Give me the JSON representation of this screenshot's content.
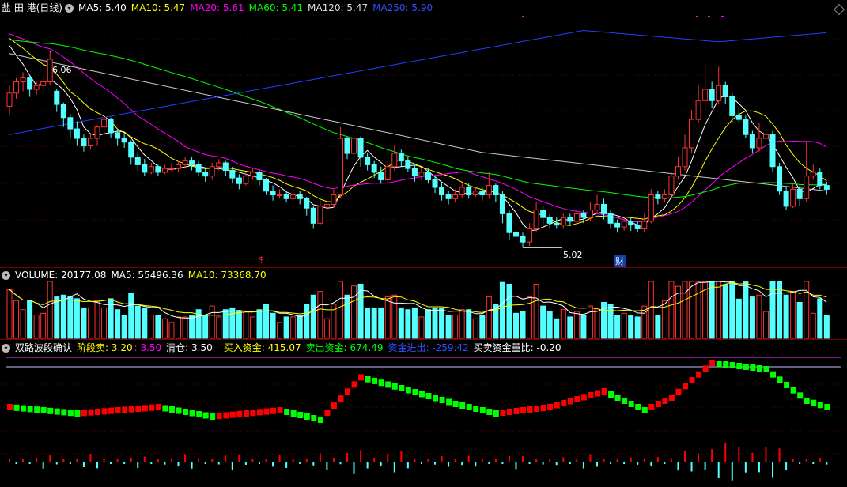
{
  "header": {
    "stock_name": "盐 田 港(日线)",
    "ma5": "MA5: 5.40",
    "ma10": "MA10: 5.47",
    "ma20": "MA20: 5.61",
    "ma60": "MA60: 5.41",
    "ma120": "MA120: 5.47",
    "ma250": "MA250: 5.90",
    "high_marker": "6.06",
    "low_marker": "5.02",
    "event_s": "$",
    "event_cai": "财"
  },
  "volume_header": {
    "volume": "VOLUME: 20177.08",
    "ma5": "MA5: 55496.36",
    "ma10": "MA10: 73368.70"
  },
  "indicator_header": {
    "name": "双路波段确认",
    "stage_sell": "阶段卖: 3.20",
    "stage_sell2": ": 3.50",
    "clear": "清仓: 3.50",
    "buy_funds": "买入资金: 415.07",
    "sell_funds": "卖出资金: 674.49",
    "funds_out": "资金进出: -259.42",
    "ratio": "买卖资金量比: -0.20"
  },
  "colors": {
    "up": "#ff3232",
    "down": "#54ffff",
    "ma5": "#ffffff",
    "ma10": "#ffff00",
    "ma20": "#ff00ff",
    "ma60": "#00ff00",
    "ma120": "#c8c8c8",
    "ma250": "#2040ff",
    "bar_up": "#ff0000",
    "bar_down": "#00ff00"
  },
  "chart_data": [
    {
      "type": "candlestick",
      "title": "盐 田 港(日线)",
      "ylim": [
        4.95,
        6.25
      ],
      "high_label": 6.06,
      "low_label": 5.02,
      "candles": [
        [
          5.77,
          5.84,
          5.88,
          5.72
        ],
        [
          5.84,
          5.9,
          5.92,
          5.81
        ],
        [
          5.9,
          5.92,
          5.95,
          5.85
        ],
        [
          5.92,
          5.86,
          5.93,
          5.82
        ],
        [
          5.86,
          5.88,
          5.9,
          5.83
        ],
        [
          5.88,
          5.9,
          5.93,
          5.85
        ],
        [
          5.9,
          6.02,
          6.06,
          5.88
        ],
        [
          5.85,
          5.78,
          5.86,
          5.74
        ],
        [
          5.78,
          5.71,
          5.79,
          5.66
        ],
        [
          5.71,
          5.65,
          5.73,
          5.6
        ],
        [
          5.65,
          5.6,
          5.69,
          5.56
        ],
        [
          5.6,
          5.56,
          5.62,
          5.53
        ],
        [
          5.56,
          5.6,
          5.63,
          5.54
        ],
        [
          5.6,
          5.66,
          5.67,
          5.56
        ],
        [
          5.66,
          5.7,
          5.72,
          5.63
        ],
        [
          5.7,
          5.63,
          5.71,
          5.6
        ],
        [
          5.63,
          5.6,
          5.65,
          5.56
        ],
        [
          5.6,
          5.58,
          5.62,
          5.55
        ],
        [
          5.58,
          5.5,
          5.59,
          5.46
        ],
        [
          5.5,
          5.46,
          5.53,
          5.43
        ],
        [
          5.46,
          5.42,
          5.49,
          5.4
        ],
        [
          5.42,
          5.45,
          5.47,
          5.41
        ],
        [
          5.45,
          5.42,
          5.46,
          5.4
        ],
        [
          5.42,
          5.44,
          5.46,
          5.41
        ],
        [
          5.44,
          5.44,
          5.47,
          5.42
        ],
        [
          5.44,
          5.46,
          5.48,
          5.42
        ],
        [
          5.46,
          5.48,
          5.5,
          5.44
        ],
        [
          5.48,
          5.46,
          5.5,
          5.43
        ],
        [
          5.46,
          5.42,
          5.48,
          5.4
        ],
        [
          5.42,
          5.4,
          5.44,
          5.37
        ],
        [
          5.4,
          5.45,
          5.47,
          5.38
        ],
        [
          5.45,
          5.47,
          5.49,
          5.43
        ],
        [
          5.47,
          5.43,
          5.48,
          5.4
        ],
        [
          5.43,
          5.39,
          5.45,
          5.36
        ],
        [
          5.39,
          5.36,
          5.41,
          5.33
        ],
        [
          5.36,
          5.4,
          5.42,
          5.35
        ],
        [
          5.4,
          5.42,
          5.44,
          5.38
        ],
        [
          5.42,
          5.38,
          5.43,
          5.35
        ],
        [
          5.38,
          5.32,
          5.39,
          5.3
        ],
        [
          5.32,
          5.3,
          5.35,
          5.27
        ],
        [
          5.3,
          5.3,
          5.33,
          5.28
        ],
        [
          5.3,
          5.28,
          5.32,
          5.26
        ],
        [
          5.28,
          5.3,
          5.33,
          5.27
        ],
        [
          5.3,
          5.28,
          5.32,
          5.25
        ],
        [
          5.28,
          5.23,
          5.29,
          5.19
        ],
        [
          5.23,
          5.15,
          5.24,
          5.12
        ],
        [
          5.15,
          5.24,
          5.27,
          5.14
        ],
        [
          5.24,
          5.25,
          5.28,
          5.22
        ],
        [
          5.25,
          5.3,
          5.33,
          5.23
        ],
        [
          5.3,
          5.6,
          5.66,
          5.28
        ],
        [
          5.6,
          5.52,
          5.61,
          5.49
        ],
        [
          5.52,
          5.6,
          5.67,
          5.5
        ],
        [
          5.6,
          5.5,
          5.61,
          5.45
        ],
        [
          5.5,
          5.46,
          5.52,
          5.43
        ],
        [
          5.46,
          5.42,
          5.48,
          5.39
        ],
        [
          5.42,
          5.38,
          5.45,
          5.36
        ],
        [
          5.38,
          5.45,
          5.48,
          5.36
        ],
        [
          5.45,
          5.52,
          5.56,
          5.43
        ],
        [
          5.52,
          5.48,
          5.54,
          5.45
        ],
        [
          5.48,
          5.44,
          5.5,
          5.42
        ],
        [
          5.44,
          5.4,
          5.46,
          5.37
        ],
        [
          5.4,
          5.42,
          5.44,
          5.38
        ],
        [
          5.42,
          5.38,
          5.44,
          5.36
        ],
        [
          5.38,
          5.34,
          5.4,
          5.31
        ],
        [
          5.34,
          5.3,
          5.36,
          5.27
        ],
        [
          5.3,
          5.28,
          5.32,
          5.25
        ],
        [
          5.28,
          5.3,
          5.33,
          5.26
        ],
        [
          5.3,
          5.34,
          5.36,
          5.28
        ],
        [
          5.34,
          5.3,
          5.36,
          5.28
        ],
        [
          5.3,
          5.32,
          5.34,
          5.29
        ],
        [
          5.32,
          5.3,
          5.34,
          5.27
        ],
        [
          5.3,
          5.35,
          5.42,
          5.28
        ],
        [
          5.35,
          5.3,
          5.36,
          5.26
        ],
        [
          5.3,
          5.2,
          5.32,
          5.15
        ],
        [
          5.2,
          5.1,
          5.22,
          5.06
        ],
        [
          5.1,
          5.08,
          5.13,
          5.05
        ],
        [
          5.08,
          5.05,
          5.1,
          5.02
        ],
        [
          5.05,
          5.12,
          5.15,
          5.03
        ],
        [
          5.12,
          5.22,
          5.26,
          5.1
        ],
        [
          5.22,
          5.18,
          5.24,
          5.14
        ],
        [
          5.18,
          5.15,
          5.2,
          5.12
        ],
        [
          5.15,
          5.14,
          5.18,
          5.12
        ],
        [
          5.14,
          5.18,
          5.2,
          5.12
        ],
        [
          5.18,
          5.16,
          5.2,
          5.14
        ],
        [
          5.16,
          5.2,
          5.22,
          5.15
        ],
        [
          5.2,
          5.18,
          5.22,
          5.15
        ],
        [
          5.18,
          5.22,
          5.26,
          5.16
        ],
        [
          5.22,
          5.25,
          5.3,
          5.2
        ],
        [
          5.25,
          5.2,
          5.28,
          5.17
        ],
        [
          5.2,
          5.15,
          5.22,
          5.12
        ],
        [
          5.15,
          5.13,
          5.17,
          5.1
        ],
        [
          5.13,
          5.16,
          5.18,
          5.11
        ],
        [
          5.16,
          5.14,
          5.18,
          5.11
        ],
        [
          5.14,
          5.12,
          5.16,
          5.1
        ],
        [
          5.12,
          5.16,
          5.2,
          5.1
        ],
        [
          5.16,
          5.3,
          5.33,
          5.15
        ],
        [
          5.3,
          5.28,
          5.32,
          5.25
        ],
        [
          5.28,
          5.3,
          5.33,
          5.26
        ],
        [
          5.3,
          5.4,
          5.42,
          5.28
        ],
        [
          5.4,
          5.45,
          5.5,
          5.38
        ],
        [
          5.45,
          5.55,
          5.62,
          5.43
        ],
        [
          5.55,
          5.7,
          5.75,
          5.52
        ],
        [
          5.7,
          5.8,
          5.88,
          5.68
        ],
        [
          5.8,
          5.86,
          6.0,
          5.75
        ],
        [
          5.86,
          5.8,
          5.9,
          5.76
        ],
        [
          5.8,
          5.88,
          5.98,
          5.78
        ],
        [
          5.88,
          5.82,
          5.9,
          5.78
        ],
        [
          5.82,
          5.72,
          5.84,
          5.68
        ],
        [
          5.72,
          5.7,
          5.76,
          5.68
        ],
        [
          5.7,
          5.62,
          5.72,
          5.6
        ],
        [
          5.62,
          5.55,
          5.64,
          5.52
        ],
        [
          5.55,
          5.6,
          5.68,
          5.53
        ],
        [
          5.6,
          5.62,
          5.66,
          5.57
        ],
        [
          5.62,
          5.45,
          5.64,
          5.42
        ],
        [
          5.45,
          5.32,
          5.47,
          5.3
        ],
        [
          5.32,
          5.24,
          5.34,
          5.22
        ],
        [
          5.24,
          5.33,
          5.36,
          5.23
        ],
        [
          5.33,
          5.28,
          5.35,
          5.24
        ],
        [
          5.28,
          5.4,
          5.58,
          5.26
        ],
        [
          5.4,
          5.42,
          5.46,
          5.38
        ],
        [
          5.42,
          5.35,
          5.44,
          5.33
        ],
        [
          5.35,
          5.33,
          5.37,
          5.3
        ]
      ],
      "ma_labels": [
        "MA5",
        "MA10",
        "MA20",
        "MA60",
        "MA120",
        "MA250"
      ]
    },
    {
      "type": "bar",
      "title": "VOLUME",
      "value": 20177.08,
      "ma5": 55496.36,
      "ma10": 73368.7
    },
    {
      "type": "bar",
      "title": "双路波段确认",
      "values": {
        "阶段卖": 3.2,
        "阶段卖2": 3.5,
        "清仓": 3.5,
        "买入资金": 415.07,
        "卖出资金": 674.49,
        "资金进出": -259.42,
        "买卖资金量比": -0.2
      }
    }
  ]
}
